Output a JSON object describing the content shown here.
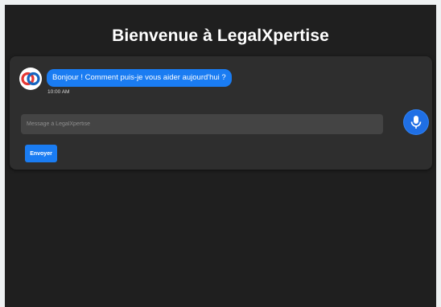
{
  "header": {
    "title": "Bienvenue à LegalXpertise"
  },
  "chat": {
    "messages": [
      {
        "sender": "bot",
        "text": "Bonjour ! Comment puis-je vous aider aujourd'hui ?",
        "time": "10:00 AM"
      }
    ],
    "input": {
      "placeholder": "Message à LegalXpertise",
      "value": ""
    },
    "send_label": "Envoyer"
  },
  "icons": {
    "avatar": "bot-logo-icon",
    "mic": "microphone-icon"
  },
  "colors": {
    "accent": "#1a7cf2",
    "background": "#1f1f1f",
    "card": "#2e2e2e",
    "input": "#444444",
    "logo_red": "#e53935",
    "logo_blue": "#1565c0"
  }
}
